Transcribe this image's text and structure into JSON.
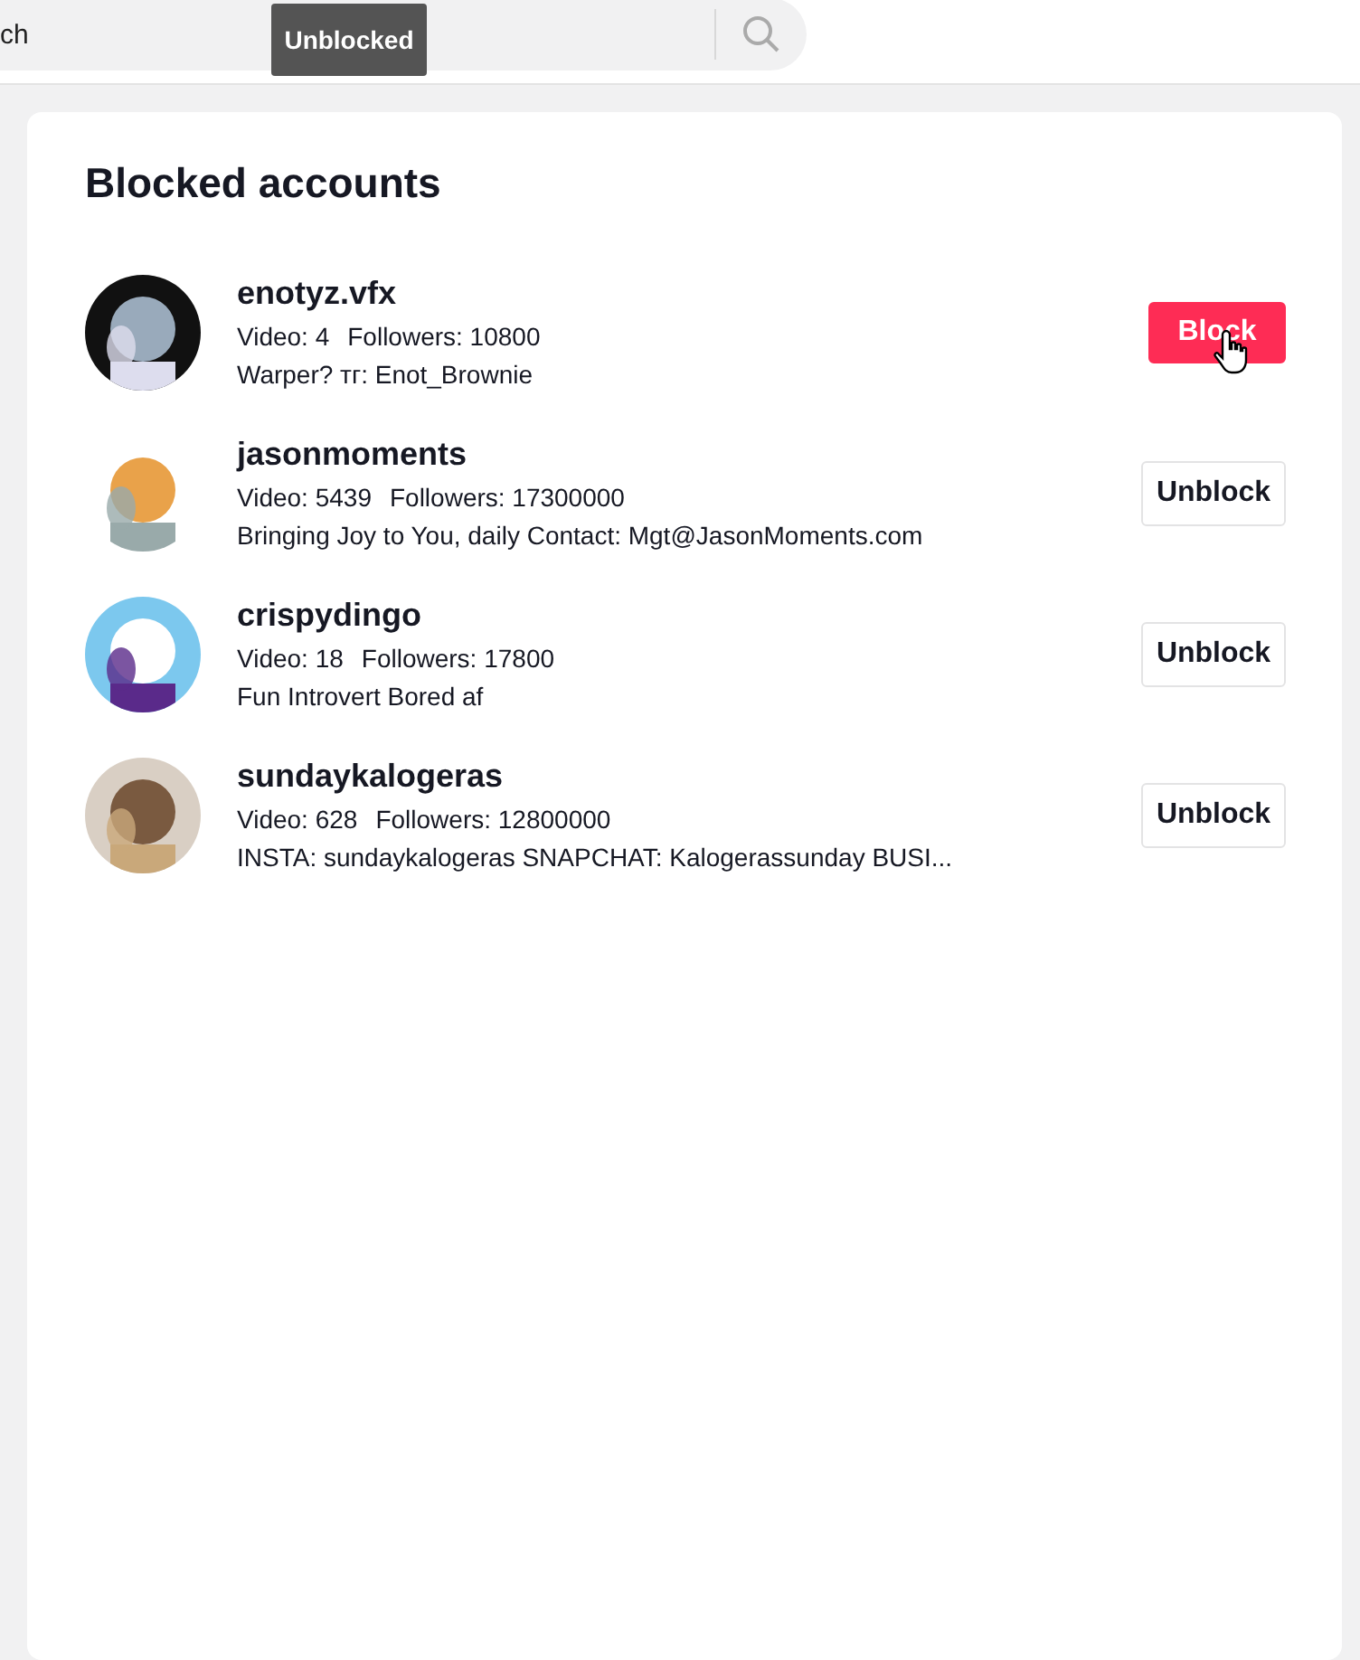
{
  "search": {
    "placeholder": "ch"
  },
  "tooltip": {
    "text": "Unblocked"
  },
  "title": "Blocked accounts",
  "accounts": [
    {
      "name": "enotyz.vfx",
      "videos": "Video: 4",
      "followers": "Followers: 10800",
      "bio": "Warper? тг: Enot_Brownie",
      "button": "Block",
      "blocked": false
    },
    {
      "name": "jasonmoments",
      "videos": "Video: 5439",
      "followers": "Followers: 17300000",
      "bio": "Bringing Joy to You, daily Contact: Mgt@JasonMoments.com",
      "button": "Unblock",
      "blocked": true
    },
    {
      "name": "crispydingo",
      "videos": "Video: 18",
      "followers": "Followers: 17800",
      "bio": "Fun Introvert Bored af",
      "button": "Unblock",
      "blocked": true
    },
    {
      "name": "sundaykalogeras",
      "videos": "Video: 628",
      "followers": "Followers: 12800000",
      "bio": "INSTA: sundaykalogeras SNAPCHAT: Kalogerassunday BUSI...",
      "button": "Unblock",
      "blocked": true
    }
  ]
}
